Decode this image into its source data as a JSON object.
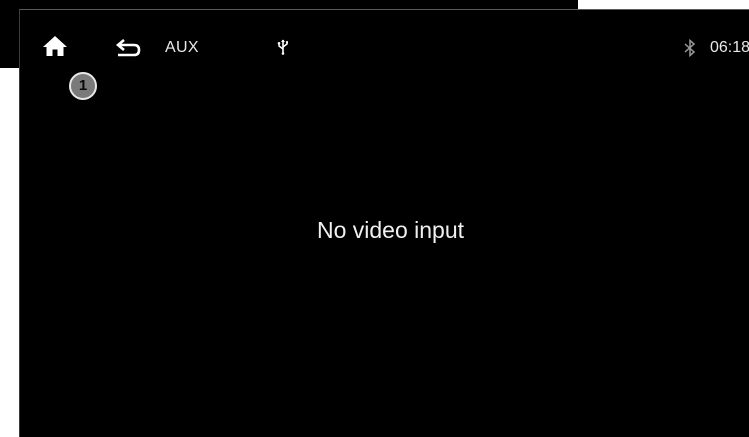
{
  "status_bar": {
    "source_label": "AUX",
    "clock": "06:18",
    "icons": {
      "home": "home-icon",
      "back": "back-arrow-icon",
      "usb": "usb-icon",
      "bluetooth": "bluetooth-icon"
    }
  },
  "callout": {
    "number": "1"
  },
  "main": {
    "message": "No video input"
  },
  "colors": {
    "screen_background": "#000000",
    "text": "#e8e8e8",
    "icon": "#ffffff",
    "bluetooth_icon": "#9a9a9a",
    "badge_fill": "#7a7a7a"
  }
}
